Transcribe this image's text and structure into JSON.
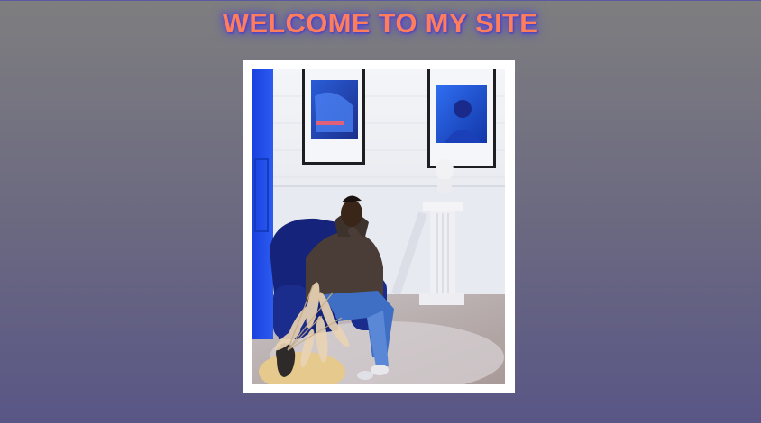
{
  "header": {
    "title": "WELCOME TO MY SITE"
  },
  "colors": {
    "title": "#ff7d5a",
    "title_glow": "#4b3fd0",
    "background_top": "#7e7e80",
    "background_bottom": "#595686"
  },
  "photo": {
    "subject": "man-seated-in-blue-armchair",
    "elements": [
      "framed-poster-left",
      "framed-poster-right",
      "bust-on-pedestal",
      "blue-door",
      "pampas-grass-vase"
    ]
  }
}
